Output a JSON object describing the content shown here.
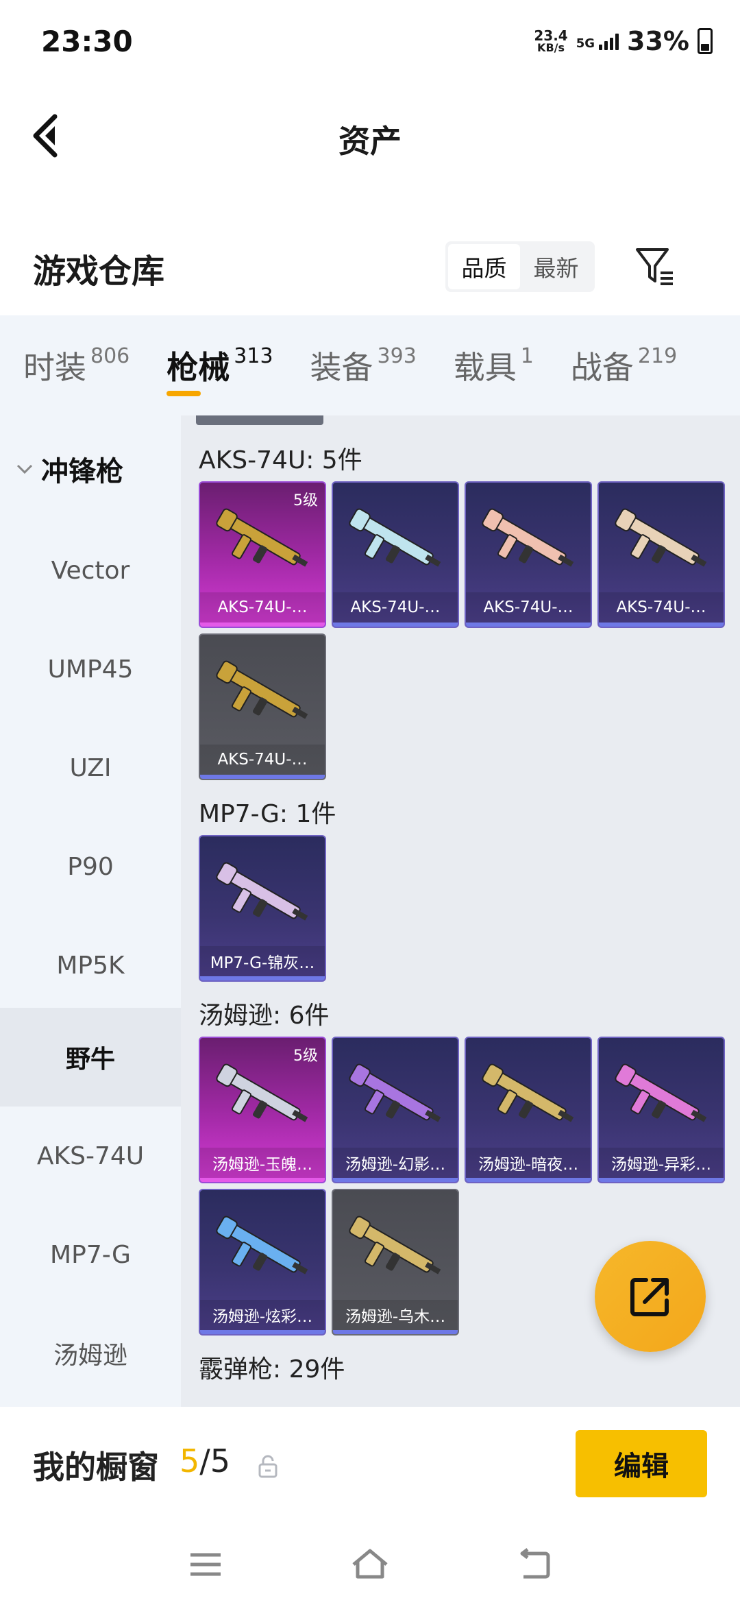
{
  "status_bar": {
    "time": "23:30",
    "net_speed_value": "23.4",
    "net_speed_unit": "KB/s",
    "network": "5G",
    "battery_percent": "33%",
    "battery_level": 0.33
  },
  "header": {
    "title": "资产"
  },
  "warehouse": {
    "title": "游戏仓库",
    "sort_options": [
      "品质",
      "最新"
    ],
    "sort_selected": "品质"
  },
  "tabs": [
    {
      "name": "时装",
      "count": "806"
    },
    {
      "name": "枪械",
      "count": "313",
      "active": true
    },
    {
      "name": "装备",
      "count": "393"
    },
    {
      "name": "载具",
      "count": "1"
    },
    {
      "name": "战备",
      "count": "219"
    }
  ],
  "side_nav": {
    "group": "冲锋枪",
    "items": [
      "Vector",
      "UMP45",
      "UZI",
      "P90",
      "MP5K",
      "野牛",
      "AKS-74U",
      "MP7-G",
      "汤姆逊"
    ],
    "selected": "野牛"
  },
  "sections": [
    {
      "title": "AKS-74U: 5件",
      "items": [
        {
          "name": "AKS-74U-…",
          "rarity": "legend",
          "level": "5级"
        },
        {
          "name": "AKS-74U-…",
          "rarity": "epic"
        },
        {
          "name": "AKS-74U-…",
          "rarity": "epic"
        },
        {
          "name": "AKS-74U-…",
          "rarity": "epic"
        },
        {
          "name": "AKS-74U-…",
          "rarity": "grey"
        }
      ]
    },
    {
      "title": "MP7-G: 1件",
      "items": [
        {
          "name": "MP7-G-锦灰…",
          "rarity": "epic"
        }
      ]
    },
    {
      "title": "汤姆逊: 6件",
      "items": [
        {
          "name": "汤姆逊-玉魄…",
          "rarity": "legend",
          "level": "5级"
        },
        {
          "name": "汤姆逊-幻影…",
          "rarity": "epic"
        },
        {
          "name": "汤姆逊-暗夜…",
          "rarity": "epic"
        },
        {
          "name": "汤姆逊-异彩…",
          "rarity": "epic"
        },
        {
          "name": "汤姆逊-炫彩…",
          "rarity": "epic"
        },
        {
          "name": "汤姆逊-乌木…",
          "rarity": "grey"
        }
      ]
    },
    {
      "title": "霰弹枪: 29件",
      "items": []
    }
  ],
  "showcase": {
    "label": "我的橱窗",
    "current": "5",
    "separator": "/",
    "max": "5",
    "edit_label": "编辑"
  },
  "icons": {
    "back": "back-arrow-icon",
    "filter": "filter-icon",
    "share": "share-icon",
    "lock": "lock-icon",
    "menu": "menu-icon",
    "home": "home-icon",
    "return": "return-icon"
  },
  "colors": {
    "accent": "#f7bf00",
    "tab_underline": "#f7a600",
    "legend_card": "#a42aa8",
    "epic_card": "#3a3470",
    "grey_card": "#55565d"
  }
}
